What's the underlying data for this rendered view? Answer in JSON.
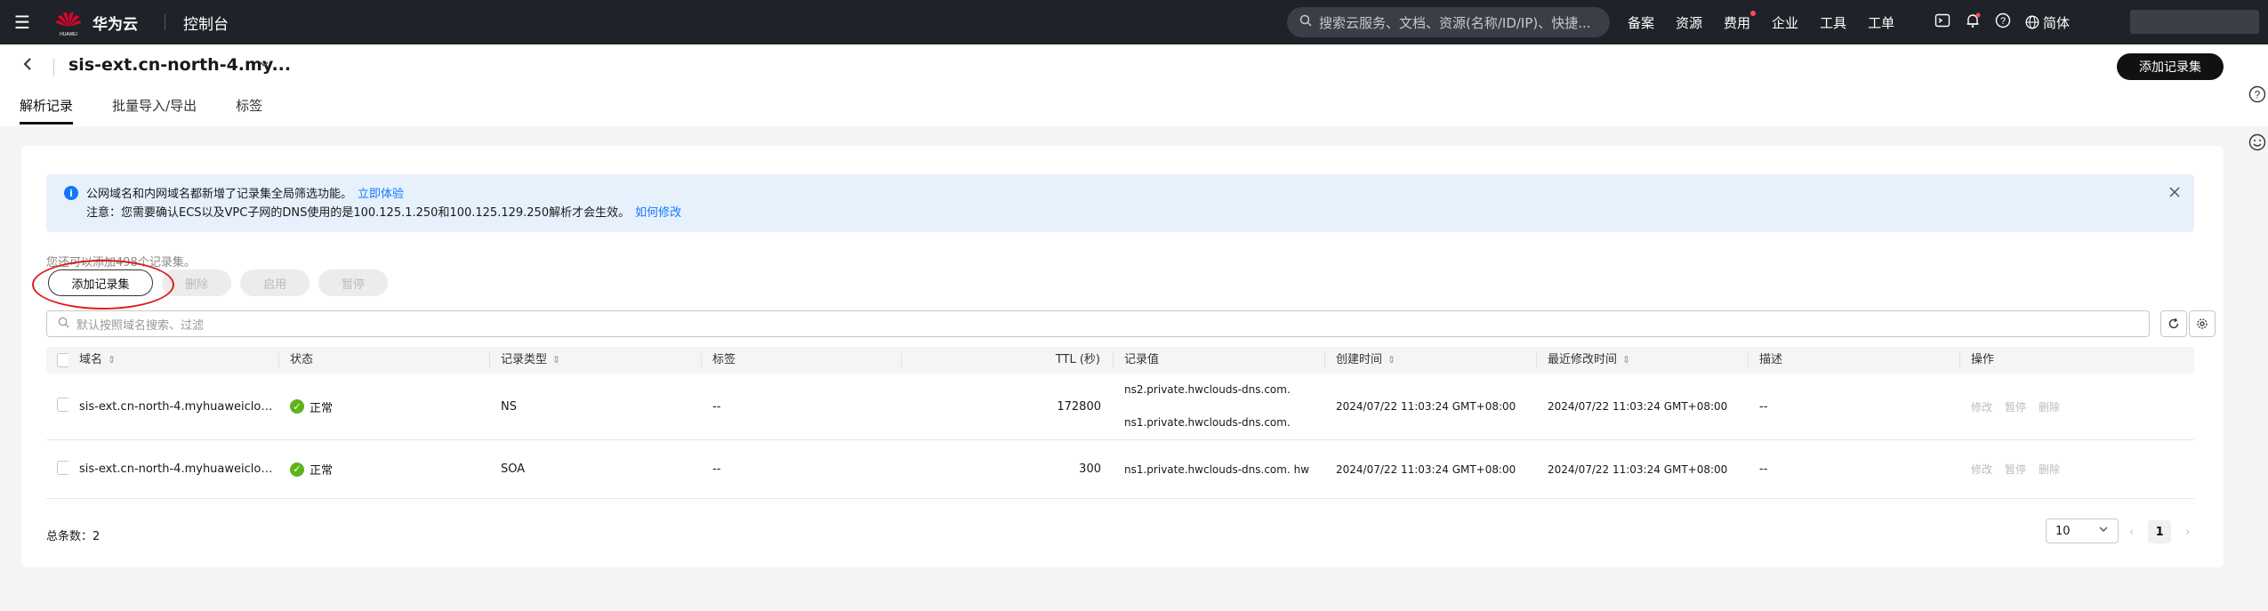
{
  "topbar": {
    "brand": "华为云",
    "logo_caption": "HUAWEI",
    "console": "控制台",
    "search_placeholder": "搜索云服务、文档、资源(名称/ID/IP)、快捷...",
    "links": [
      "备案",
      "资源",
      "费用",
      "企业",
      "工具",
      "工单"
    ],
    "lang": "简体",
    "icons": [
      "menu-icon",
      "search-icon",
      "terminal-icon",
      "bell-icon",
      "help-icon",
      "globe-icon"
    ]
  },
  "page": {
    "title": "sis-ext.cn-north-4.my...",
    "add_button": "添加记录集",
    "tabs": [
      "解析记录",
      "批量导入/导出",
      "标签"
    ]
  },
  "banner": {
    "line1": "公网域名和内网域名都新增了记录集全局筛选功能。",
    "line1_link": "立即体验",
    "line2": "注意：您需要确认ECS以及VPC子网的DNS使用的是100.125.1.250和100.125.129.250解析才会生效。",
    "line2_link": "如何修改"
  },
  "toolbar": {
    "quota": "您还可以添加498个记录集。",
    "add": "添加记录集",
    "delete": "删除",
    "enable": "启用",
    "disable": "暂停",
    "filter_placeholder": "默认按照域名搜索、过滤"
  },
  "table": {
    "headers": [
      "域名",
      "状态",
      "记录类型",
      "标签",
      "TTL (秒)",
      "记录值",
      "创建时间",
      "最近修改时间",
      "描述",
      "操作"
    ],
    "rows": [
      {
        "domain": "sis-ext.cn-north-4.myhuaweicloud....",
        "status": "正常",
        "type": "NS",
        "tag": "--",
        "ttl": "172800",
        "value1": "ns2.private.hwclouds-dns.com.",
        "value2": "ns1.private.hwclouds-dns.com.",
        "created": "2024/07/22 11:03:24 GMT+08:00",
        "modified": "2024/07/22 11:03:24 GMT+08:00",
        "desc": "--",
        "ops": [
          "修改",
          "暂停",
          "删除"
        ]
      },
      {
        "domain": "sis-ext.cn-north-4.myhuaweicloud....",
        "status": "正常",
        "type": "SOA",
        "tag": "--",
        "ttl": "300",
        "value1": "ns1.private.hwclouds-dns.com. hw",
        "created": "2024/07/22 11:03:24 GMT+08:00",
        "modified": "2024/07/22 11:03:24 GMT+08:00",
        "desc": "--",
        "ops": [
          "修改",
          "暂停",
          "删除"
        ]
      }
    ]
  },
  "footer": {
    "total": "总条数：2",
    "page_size": "10",
    "current_page": "1"
  },
  "colors": {
    "topbar": "#1f2329",
    "link": "#1476ff",
    "banner_bg": "#e6f1fc",
    "status_ok": "#5fb31a",
    "highlight": "#d81e1e"
  }
}
